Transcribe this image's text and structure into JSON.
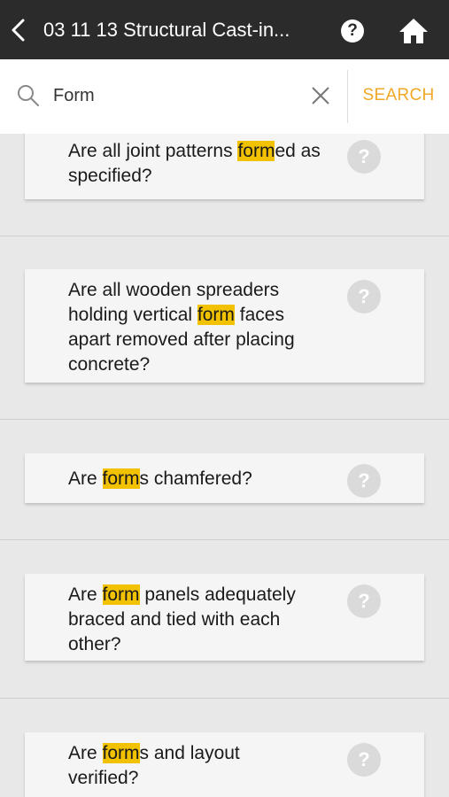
{
  "header": {
    "title": "03 11 13 Structural Cast-in...",
    "help_icon": "?",
    "home_icon": "home-icon"
  },
  "search": {
    "value": "Form",
    "button_label": "SEARCH",
    "accent": "#f0a826"
  },
  "highlight_color": "#f2c200",
  "questions": [
    {
      "pre": "Are all joint patterns ",
      "hl": "form",
      "post": "ed as specified?",
      "help": "?"
    },
    {
      "pre": "Are all wooden spreaders holding vertical ",
      "hl": "form",
      "post": " faces apart removed after placing concrete?",
      "help": "?"
    },
    {
      "pre": "Are ",
      "hl": "form",
      "post": "s chamfered?",
      "help": "?"
    },
    {
      "pre": "Are ",
      "hl": "form",
      "post": " panels adequately braced and tied with each other?",
      "help": "?"
    },
    {
      "pre": "Are ",
      "hl": "form",
      "post": "s and layout verified?",
      "help": "?"
    }
  ]
}
